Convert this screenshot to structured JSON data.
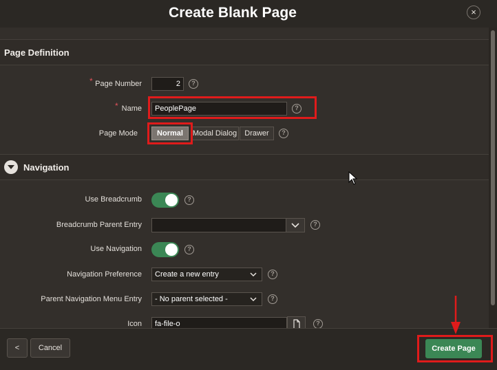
{
  "dialog": {
    "title": "Create Blank Page",
    "close_glyph": "×"
  },
  "page_definition": {
    "section_title": "Page Definition",
    "page_number_label": "Page Number",
    "page_number_value": "2",
    "name_label": "Name",
    "name_value": "PeoplePage",
    "page_mode_label": "Page Mode",
    "page_mode_options": [
      "Normal",
      "Modal Dialog",
      "Drawer"
    ],
    "page_mode_selected": "Normal",
    "required_marker": "*"
  },
  "navigation": {
    "section_title": "Navigation",
    "use_breadcrumb_label": "Use Breadcrumb",
    "use_breadcrumb_on": true,
    "breadcrumb_parent_label": "Breadcrumb Parent Entry",
    "breadcrumb_parent_value": "",
    "use_navigation_label": "Use Navigation",
    "use_navigation_on": true,
    "nav_preference_label": "Navigation Preference",
    "nav_preference_value": "Create a new entry",
    "parent_nav_label": "Parent Navigation Menu Entry",
    "parent_nav_value": "- No parent selected -",
    "icon_label": "Icon",
    "icon_value": "fa-file-o"
  },
  "footer": {
    "back_glyph": "<",
    "cancel_label": "Cancel",
    "create_label": "Create Page"
  },
  "help_glyph": "?",
  "colors": {
    "accent": "#3b8755",
    "highlight": "#e01b1b",
    "required": "#e0525b"
  }
}
